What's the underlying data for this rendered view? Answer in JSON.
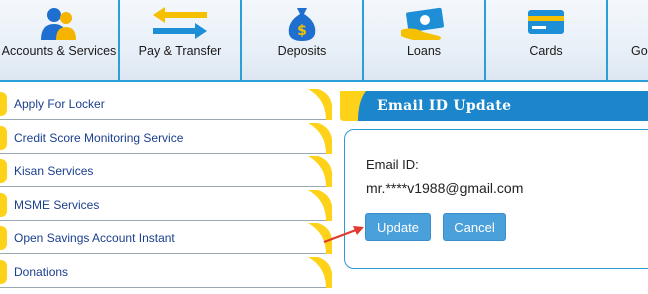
{
  "nav": {
    "items": [
      {
        "label": "Accounts & Services",
        "icon": "users-icon"
      },
      {
        "label": "Pay & Transfer",
        "icon": "transfer-arrows-icon"
      },
      {
        "label": "Deposits",
        "icon": "money-bag-icon"
      },
      {
        "label": "Loans",
        "icon": "cash-hand-icon"
      },
      {
        "label": "Cards",
        "icon": "card-icon"
      },
      {
        "label": "Go",
        "icon": "generic-icon"
      }
    ]
  },
  "menu": {
    "items": [
      {
        "label": "Apply For Locker"
      },
      {
        "label": "Credit Score Monitoring Service"
      },
      {
        "label": "Kisan Services"
      },
      {
        "label": "MSME Services"
      },
      {
        "label": "Open Savings Account Instant"
      },
      {
        "label": "Donations"
      }
    ]
  },
  "panel": {
    "title": "Email ID Update",
    "email_label": "Email ID:",
    "email_value": "mr.****v1988@gmail.com",
    "update_label": "Update",
    "cancel_label": "Cancel"
  },
  "colors": {
    "accent_blue": "#2a9fd8",
    "accent_yellow": "#ffd21a",
    "button_blue": "#4aa0da",
    "annotation_red": "#e03a2f"
  }
}
